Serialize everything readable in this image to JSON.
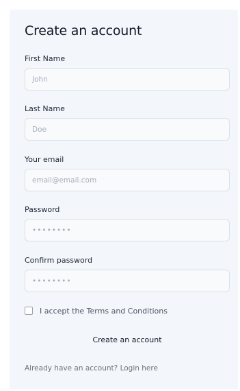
{
  "form": {
    "title": "Create an account",
    "fields": [
      {
        "label": "First Name",
        "placeholder": "John",
        "type": "text"
      },
      {
        "label": "Last Name",
        "placeholder": "Doe",
        "type": "text"
      },
      {
        "label": "Your email",
        "placeholder": "email@email.com",
        "type": "email"
      },
      {
        "label": "Password",
        "placeholder": "••••••••",
        "type": "password"
      },
      {
        "label": "Confirm password",
        "placeholder": "••••••••",
        "type": "password"
      }
    ],
    "terms_label": "I accept the Terms and Conditions",
    "terms_checked": false,
    "submit_label": "Create an account",
    "login_prompt": "Already have an account?",
    "login_link": "Login here"
  },
  "colors": {
    "card_background": "#f3f6fa",
    "input_border": "#dbe1e8",
    "text_primary": "#111827",
    "text_muted": "#6b7280"
  }
}
